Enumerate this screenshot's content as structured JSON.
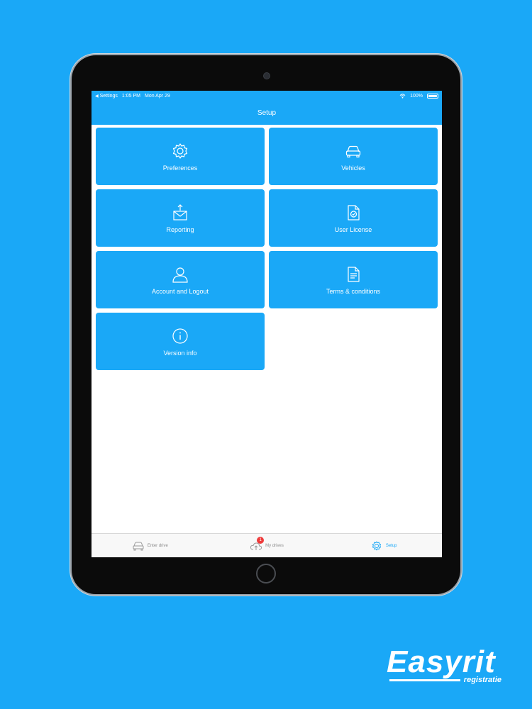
{
  "status_bar": {
    "back_label": "Settings",
    "time": "1:05 PM",
    "date": "Mon Apr 29",
    "battery": "100%"
  },
  "nav": {
    "title": "Setup"
  },
  "tiles": [
    {
      "label": "Preferences",
      "icon": "gear-icon"
    },
    {
      "label": "Vehicles",
      "icon": "car-icon"
    },
    {
      "label": "Reporting",
      "icon": "mail-upload-icon"
    },
    {
      "label": "User License",
      "icon": "license-icon"
    },
    {
      "label": "Account and Logout",
      "icon": "user-icon"
    },
    {
      "label": "Terms & conditions",
      "icon": "document-icon"
    },
    {
      "label": "Version info",
      "icon": "info-icon"
    }
  ],
  "tab_bar": {
    "enter_drive": "Enter drive",
    "my_drives": "My drives",
    "my_drives_badge": "1",
    "setup": "Setup"
  },
  "logo": {
    "name": "Easyrit",
    "sub": "registratie"
  },
  "colors": {
    "accent": "#1aa8f7",
    "badge": "#ee3b3b",
    "background": "#1aa8f7"
  }
}
